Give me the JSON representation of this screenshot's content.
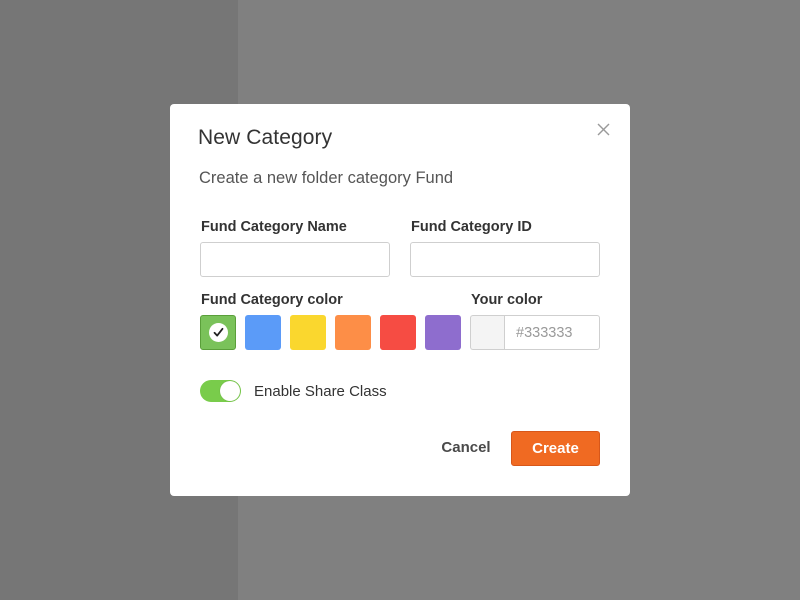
{
  "modal": {
    "title": "New Category",
    "subtitle": "Create a new folder category Fund",
    "fields": {
      "name_label": "Fund Category Name",
      "name_value": "",
      "id_label": "Fund Category ID",
      "id_value": ""
    },
    "color": {
      "label": "Fund Category color",
      "swatches": [
        "#7ac25a",
        "#5b9bf8",
        "#fad72e",
        "#fd8e47",
        "#f64c43",
        "#8e6dce"
      ],
      "selected_index": 0,
      "custom_label": "Your color",
      "custom_placeholder": "#333333"
    },
    "toggle": {
      "label": "Enable Share Class",
      "enabled": true
    },
    "actions": {
      "cancel_label": "Cancel",
      "create_label": "Create"
    }
  },
  "theme": {
    "accent": "#f06a22",
    "toggle_on": "#79cc4b"
  }
}
